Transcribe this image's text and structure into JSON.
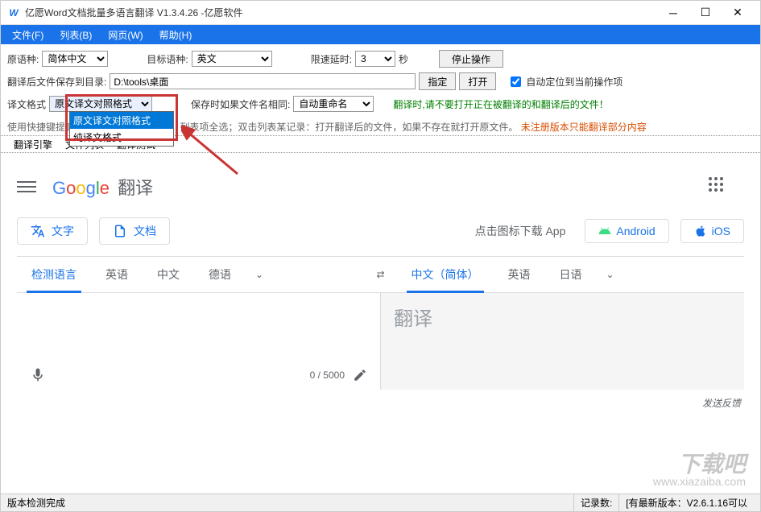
{
  "title": "亿愿Word文档批量多语言翻译 V1.3.4.26 -亿愿软件",
  "menu": {
    "file": "文件(F)",
    "list": "列表(B)",
    "web": "网页(W)",
    "help": "帮助(H)"
  },
  "row1": {
    "src_lang_label": "原语种:",
    "src_lang_value": "简体中文",
    "tgt_lang_label": "目标语种:",
    "tgt_lang_value": "英文",
    "delay_label": "限速延时:",
    "delay_value": "3",
    "seconds": "秒",
    "stop_btn": "停止操作"
  },
  "row2": {
    "save_dir_label": "翻译后文件保存到目录:",
    "save_dir_value": "D:\\tools\\桌面",
    "assign_btn": "指定",
    "open_btn": "打开",
    "auto_locate": "自动定位到当前操作项"
  },
  "row3": {
    "format_label": "译文格式",
    "format_value": "原文译文对照格式",
    "dropdown_options": [
      "原文译文对照格式",
      "纯译文格式"
    ],
    "save_same_label": "保存时如果文件名相同:",
    "save_same_value": "自动重命名",
    "warn_text": "翻译时,请不要打开正在被翻译的和翻译后的文件！"
  },
  "hints": {
    "shortcut": "使用快捷键提高操作方便性，CTRL+A：列表项全选；双击列表某记录：打开翻译后的文件，如果不存在就打开原文件。",
    "unreg": "未注册版本只能翻译部分内容"
  },
  "tabs": {
    "engine": "翻译引擎",
    "filelist": "文件列表",
    "testlist": "翻译测试"
  },
  "google": {
    "brand_translate": "翻译",
    "mode_text": "文字",
    "mode_doc": "文档",
    "download_hint": "点击图标下载 App",
    "android": "Android",
    "ios": "iOS",
    "src_tabs": [
      "检测语言",
      "英语",
      "中文",
      "德语"
    ],
    "tgt_tabs": [
      "中文（简体）",
      "英语",
      "日语"
    ],
    "tgt_placeholder": "翻译",
    "char_count": "0 / 5000",
    "feedback": "发送反馈"
  },
  "status": {
    "left": "版本检测完成",
    "records": "记录数:",
    "version": "[有最新版本：V2.6.1.16可以"
  },
  "watermark": {
    "big": "下载吧",
    "domain": "www.xiazaiba.com"
  }
}
